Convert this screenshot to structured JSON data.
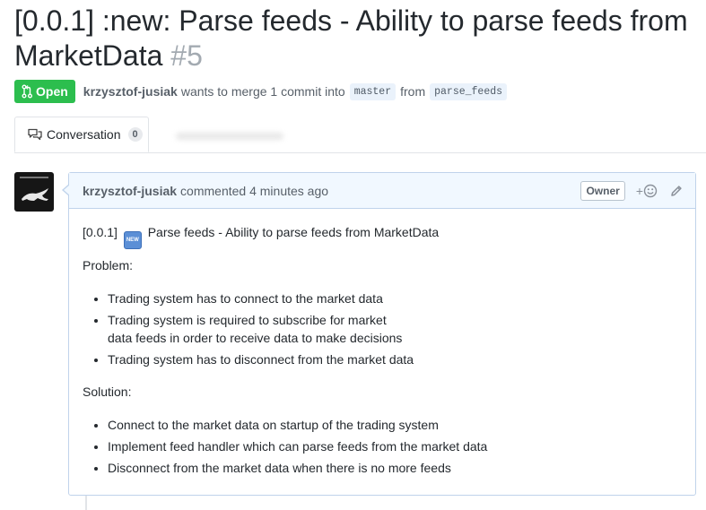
{
  "pr": {
    "title": "[0.0.1] :new: Parse feeds - Ability to parse feeds from MarketData",
    "number": "#5",
    "state": "Open",
    "author": "krzysztof-jusiak",
    "merge_text": "wants to merge 1 commit into",
    "base_branch": "master",
    "from_text": "from",
    "head_branch": "parse_feeds"
  },
  "tabs": {
    "conversation_label": "Conversation",
    "conversation_count": "0"
  },
  "comment": {
    "author": "krzysztof-jusiak",
    "time": "commented 4 minutes ago",
    "owner_label": "Owner",
    "react_plus": "+",
    "body": {
      "title_prefix": "[0.0.1]",
      "title_emoji": "NEW",
      "title_rest": "Parse feeds - Ability to parse feeds from MarketData",
      "problem_heading": "Problem:",
      "problems": [
        "Trading system has to connect to the market data",
        "Trading system is required to subscribe for market",
        "data feeds in order to receive data to make decisions",
        "Trading system has to disconnect from the market data"
      ],
      "solution_heading": "Solution:",
      "solutions": [
        "Connect to the market data on startup of the trading system",
        "Implement feed handler which can parse feeds from the market data",
        "Disconnect from the market data when there is no more feeds"
      ]
    }
  },
  "colors": {
    "open_green": "#2cbe4e",
    "comment_header_bg": "#f1f8ff",
    "comment_border": "#c0d3eb"
  },
  "icons": [
    "git-pull-request-icon",
    "comment-discussion-icon",
    "smiley-icon",
    "pencil-icon"
  ]
}
